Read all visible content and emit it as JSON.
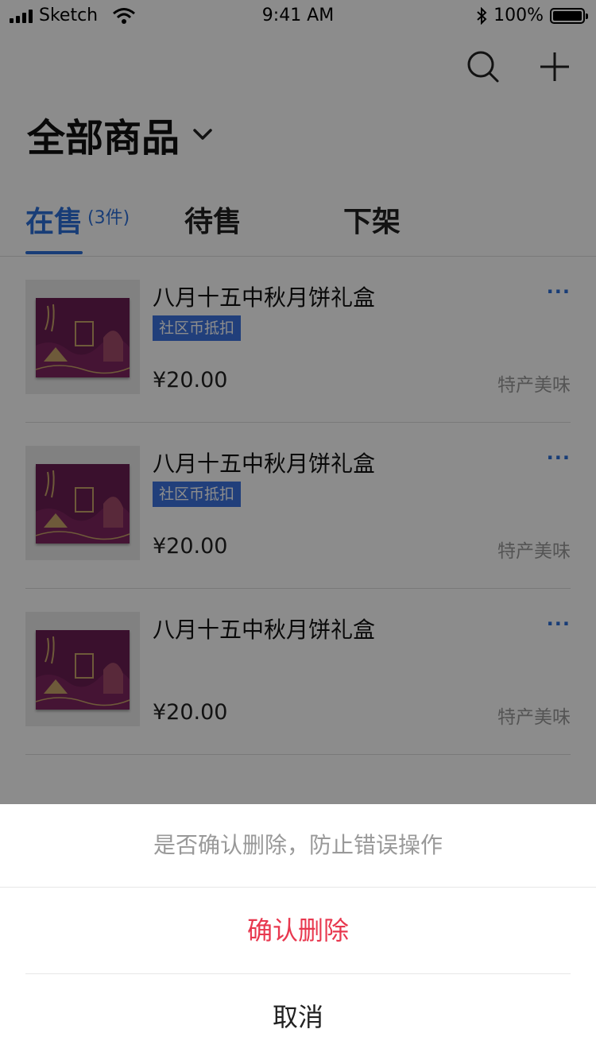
{
  "status_bar": {
    "carrier": "Sketch",
    "time": "9:41 AM",
    "battery": "100%",
    "battery_level": 1.0,
    "icons": [
      "signal-icon",
      "wifi-icon",
      "bluetooth-icon",
      "battery-icon"
    ]
  },
  "header": {
    "title": "全部商品",
    "actions": [
      "search-icon",
      "plus-icon"
    ]
  },
  "tabs": [
    {
      "label": "在售",
      "count": "(3件)",
      "active": true
    },
    {
      "label": "待售",
      "count": "",
      "active": false
    },
    {
      "label": "下架",
      "count": "",
      "active": false
    }
  ],
  "products": [
    {
      "name": "八月十五中秋月饼礼盒",
      "tag": "社区币抵扣",
      "price": "¥20.00",
      "category": "特产美味",
      "more": "···"
    },
    {
      "name": "八月十五中秋月饼礼盒",
      "tag": "社区币抵扣",
      "price": "¥20.00",
      "category": "特产美味",
      "more": "···"
    },
    {
      "name": "八月十五中秋月饼礼盒",
      "tag": "",
      "price": "¥20.00",
      "category": "特产美味",
      "more": "···"
    }
  ],
  "action_sheet": {
    "message": "是否确认删除，防止错误操作",
    "confirm_label": "确认删除",
    "cancel_label": "取消"
  },
  "colors": {
    "accent": "#2d6fd9",
    "danger": "#e8384f",
    "tag_bg": "#3c74e0",
    "overlay": "rgba(0,0,0,0.45)"
  }
}
